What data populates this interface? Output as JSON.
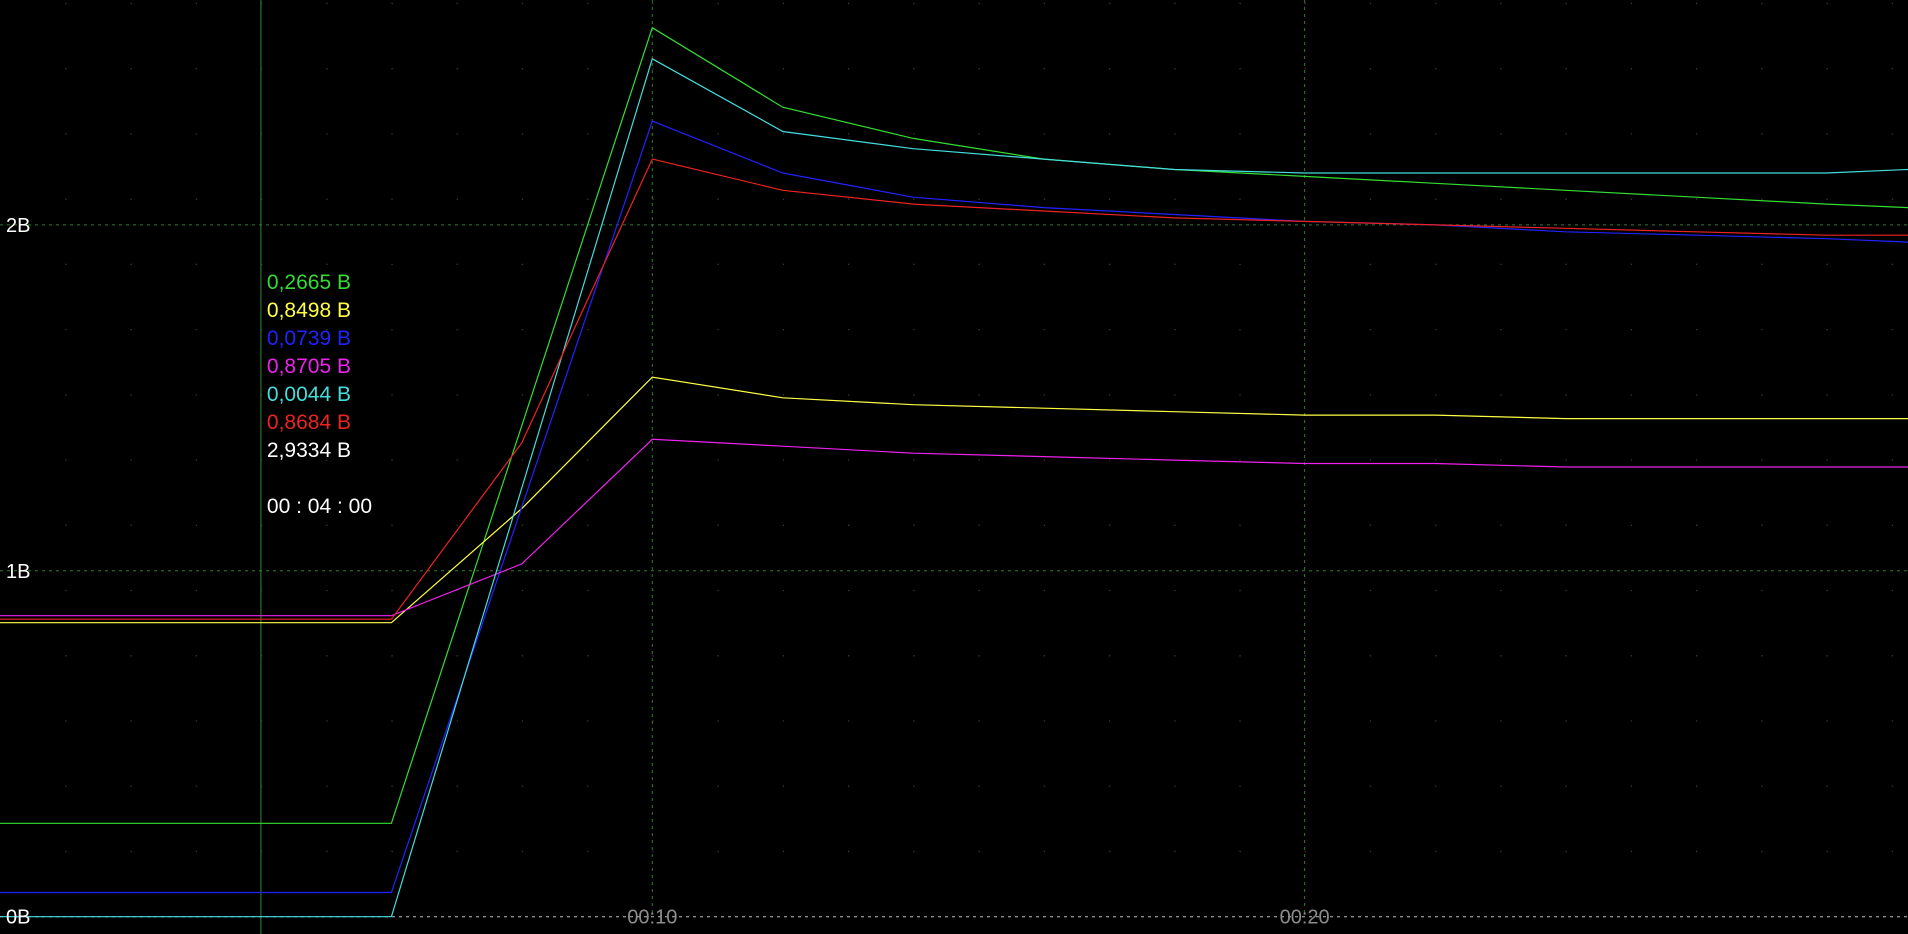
{
  "chart_data": {
    "type": "line",
    "background": "#000000",
    "grid": true,
    "xlabel": "",
    "ylabel": "",
    "xlim": [
      0,
      29.25
    ],
    "ylim": [
      -0.05,
      2.65
    ],
    "y_ticks": [
      {
        "value": 0,
        "label": "0B"
      },
      {
        "value": 1,
        "label": "1B"
      },
      {
        "value": 2,
        "label": "2B"
      }
    ],
    "x_ticks": [
      {
        "value": 10,
        "label": "00:10"
      },
      {
        "value": 20,
        "label": "00:20"
      }
    ],
    "cursor": {
      "x": 4,
      "time_label": "00 : 04 : 00"
    },
    "series": [
      {
        "color": "#33dd33",
        "readout": "0,2665 B",
        "x": [
          0,
          6,
          10,
          12,
          14,
          16,
          18,
          20,
          22,
          24,
          26,
          28,
          29.25
        ],
        "y": [
          0.27,
          0.27,
          2.57,
          2.34,
          2.25,
          2.19,
          2.16,
          2.14,
          2.12,
          2.1,
          2.08,
          2.06,
          2.05
        ]
      },
      {
        "color": "#ffff44",
        "readout": "0,8498 B",
        "x": [
          0,
          6,
          8,
          10,
          12,
          14,
          16,
          18,
          20,
          22,
          24,
          26,
          28,
          29.25
        ],
        "y": [
          0.85,
          0.85,
          1.18,
          1.56,
          1.5,
          1.48,
          1.47,
          1.46,
          1.45,
          1.45,
          1.44,
          1.44,
          1.44,
          1.44
        ]
      },
      {
        "color": "#2222ff",
        "readout": "0,0739 B",
        "x": [
          0,
          6,
          10,
          12,
          14,
          16,
          18,
          20,
          22,
          24,
          26,
          28,
          29.25
        ],
        "y": [
          0.07,
          0.07,
          2.3,
          2.15,
          2.08,
          2.05,
          2.03,
          2.01,
          2.0,
          1.98,
          1.97,
          1.96,
          1.95
        ]
      },
      {
        "color": "#ee22ee",
        "readout": "0,8705 B",
        "x": [
          0,
          6,
          8,
          10,
          12,
          14,
          16,
          18,
          20,
          22,
          24,
          26,
          28,
          29.25
        ],
        "y": [
          0.87,
          0.87,
          1.02,
          1.38,
          1.36,
          1.34,
          1.33,
          1.32,
          1.31,
          1.31,
          1.3,
          1.3,
          1.3,
          1.3
        ]
      },
      {
        "color": "#44dddd",
        "readout": "0,0044 B",
        "x": [
          0,
          6,
          10,
          12,
          14,
          16,
          18,
          20,
          22,
          24,
          26,
          28,
          29.25
        ],
        "y": [
          0.0,
          0.0,
          2.48,
          2.27,
          2.22,
          2.19,
          2.16,
          2.15,
          2.15,
          2.15,
          2.15,
          2.15,
          2.16
        ]
      },
      {
        "color": "#ee2222",
        "readout": "0,8684 B",
        "x": [
          0,
          6,
          8,
          10,
          12,
          14,
          16,
          18,
          20,
          22,
          24,
          26,
          28,
          29.25
        ],
        "y": [
          0.86,
          0.86,
          1.37,
          2.19,
          2.1,
          2.06,
          2.04,
          2.02,
          2.01,
          2.0,
          1.99,
          1.98,
          1.97,
          1.97
        ]
      },
      {
        "color": "#ffffff",
        "readout": "2,9334 B",
        "x": [],
        "y": []
      }
    ]
  }
}
